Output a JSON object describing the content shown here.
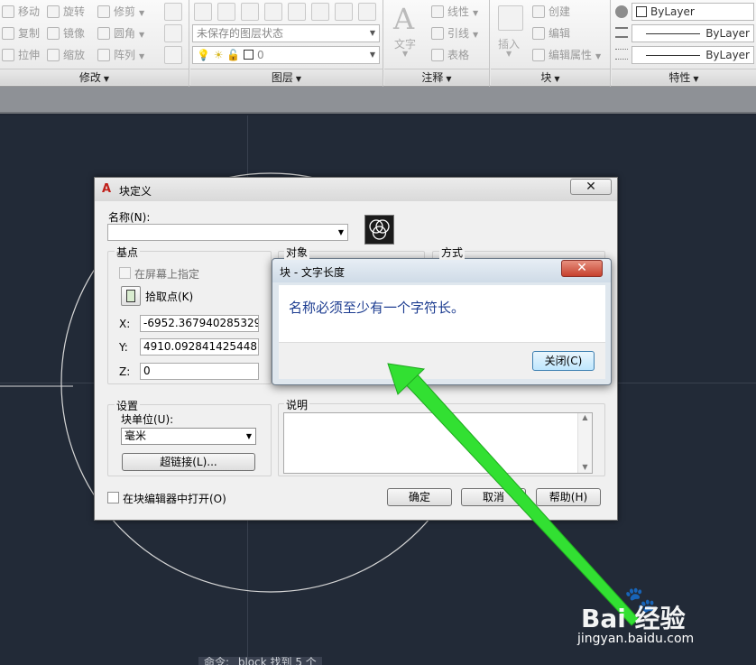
{
  "ribbon": {
    "modify": {
      "title": "修改",
      "items": [
        "移动",
        "旋转",
        "修剪",
        "复制",
        "镜像",
        "圆角",
        "拉伸",
        "缩放",
        "阵列"
      ]
    },
    "layers": {
      "title": "图层",
      "layer_state": "未保存的图层状态",
      "current_layer": "0"
    },
    "annotation": {
      "title": "注释",
      "text_label": "文字",
      "items": [
        "线性",
        "引线",
        "表格"
      ]
    },
    "block": {
      "title": "块",
      "insert_label": "插入",
      "items": [
        "创建",
        "编辑",
        "编辑属性"
      ]
    },
    "properties": {
      "title": "特性",
      "color": "ByLayer",
      "linetype": "ByLayer",
      "lineweight": "ByLayer"
    }
  },
  "block_dialog": {
    "title": "块定义",
    "name_label": "名称(N):",
    "name_value": "",
    "base_point": {
      "group_label": "基点",
      "specify_on_screen": "在屏幕上指定",
      "pick_point": "拾取点(K)",
      "x_label": "X:",
      "x_value": "-6952.367940285329",
      "y_label": "Y:",
      "y_value": "4910.092841425448",
      "z_label": "Z:",
      "z_value": "0"
    },
    "objects_label": "对象",
    "behavior_label": "方式",
    "settings": {
      "group_label": "设置",
      "unit_label": "块单位(U):",
      "unit_value": "毫米",
      "hyperlink_button": "超链接(L)..."
    },
    "description_label": "说明",
    "open_in_editor": "在块编辑器中打开(O)",
    "ok_button": "确定",
    "cancel_button": "取消",
    "help_button": "帮助(H)"
  },
  "alert_dialog": {
    "title": "块 - 文字长度",
    "message": "名称必须至少有一个字符长。",
    "close_button": "关闭(C)"
  },
  "command_line": "命令: _block 找到 5 个",
  "watermark": {
    "brand": "Bai 经验",
    "url": "jingyan.baidu.com"
  },
  "colors": {
    "canvas": "#222a37",
    "alert_text": "#1c3c90",
    "arrow": "#32e032"
  }
}
